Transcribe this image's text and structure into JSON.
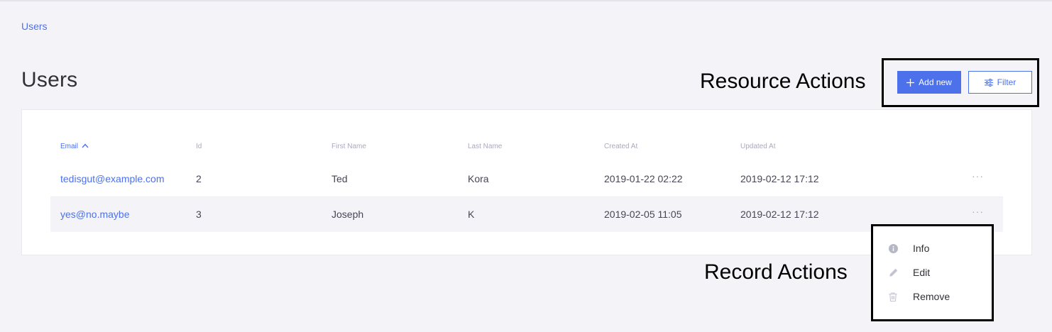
{
  "breadcrumb": "Users",
  "page_title": "Users",
  "annotations": {
    "resource_actions": "Resource Actions",
    "record_actions": "Record Actions"
  },
  "actions": {
    "add_new": "Add new",
    "filter": "Filter"
  },
  "table": {
    "columns": [
      "Email",
      "Id",
      "First Name",
      "Last Name",
      "Created At",
      "Updated At"
    ],
    "sorted_column": "Email",
    "rows": [
      {
        "email": "tedisgut@example.com",
        "id": "2",
        "first_name": "Ted",
        "last_name": "Kora",
        "created_at": "2019-01-22 02:22",
        "updated_at": "2019-02-12 17:12",
        "more": "···"
      },
      {
        "email": "yes@no.maybe",
        "id": "3",
        "first_name": "Joseph",
        "last_name": "K",
        "created_at": "2019-02-05 11:05",
        "updated_at": "2019-02-12 17:12",
        "more": "···"
      }
    ]
  },
  "record_menu": {
    "items": [
      {
        "label": "Info",
        "icon": "info-icon"
      },
      {
        "label": "Edit",
        "icon": "pencil-icon"
      },
      {
        "label": "Remove",
        "icon": "trash-icon"
      }
    ]
  },
  "colors": {
    "accent": "#4d70eb",
    "background": "#f4f4f8",
    "panel": "#ffffff",
    "muted_text": "#a9aabc"
  }
}
